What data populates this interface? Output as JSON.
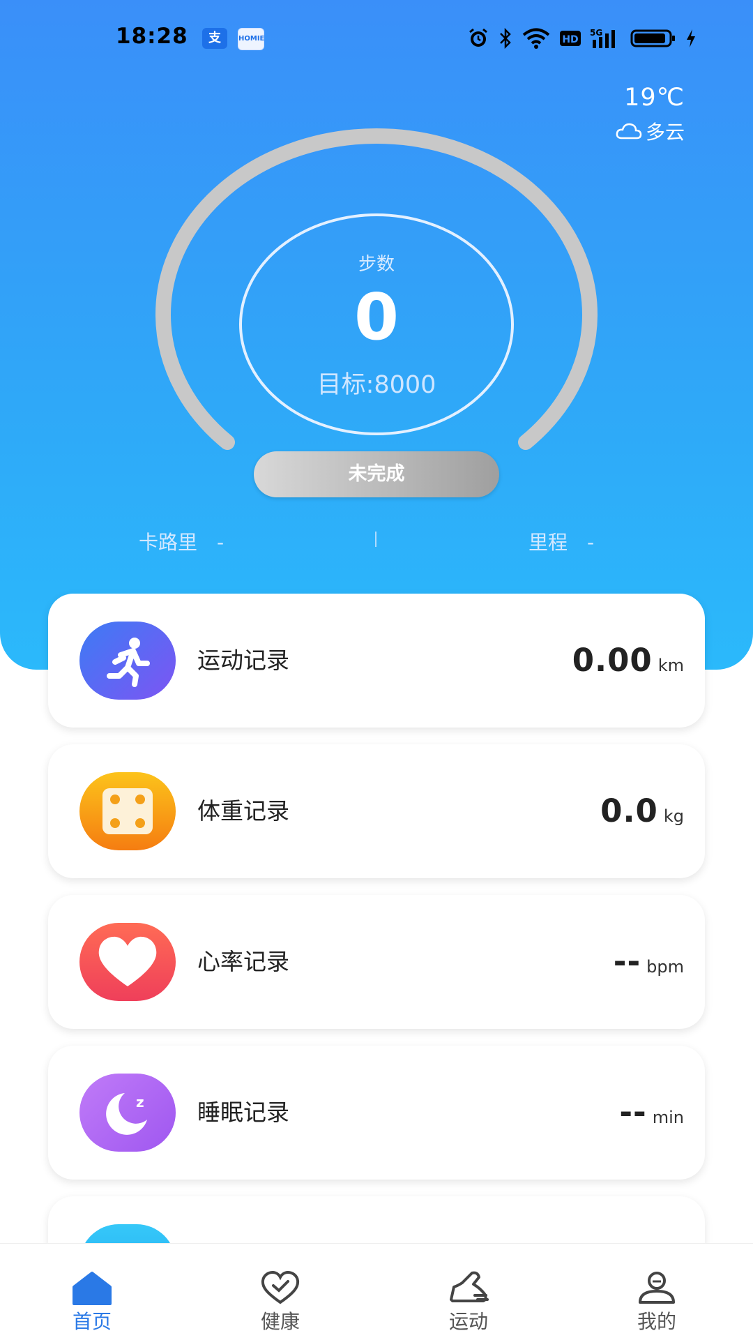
{
  "status_bar": {
    "time": "18:28",
    "app_badge_1": "支",
    "app_badge_2": "HOMIE"
  },
  "weather": {
    "temperature": "19℃",
    "condition": "多云"
  },
  "steps": {
    "label": "步数",
    "value": "0",
    "goal": "目标:8000",
    "status": "未完成"
  },
  "metrics": {
    "calories": {
      "label": "卡路里",
      "value": "-"
    },
    "distance": {
      "label": "里程",
      "value": "-"
    }
  },
  "cards": [
    {
      "title": "运动记录",
      "value": "0.00",
      "unit": "km"
    },
    {
      "title": "体重记录",
      "value": "0.0",
      "unit": "kg"
    },
    {
      "title": "心率记录",
      "value": "--",
      "unit": "bpm"
    },
    {
      "title": "睡眠记录",
      "value": "--",
      "unit": "min"
    }
  ],
  "tabs": [
    {
      "label": "首页",
      "icon": "home-icon",
      "active": true
    },
    {
      "label": "健康",
      "icon": "heart-check-icon",
      "active": false
    },
    {
      "label": "运动",
      "icon": "shoe-icon",
      "active": false
    },
    {
      "label": "我的",
      "icon": "user-icon",
      "active": false
    }
  ],
  "colors": {
    "hero_top": "#3a8ff9",
    "hero_bottom": "#2bb9fb",
    "accent": "#2a79e6",
    "run_icon": "#6a5cf0",
    "weight_icon": "#f7a81a",
    "heart_icon": "#f4504f",
    "sleep_icon": "#b36af5",
    "extra_icon": "#2bc2f7"
  }
}
